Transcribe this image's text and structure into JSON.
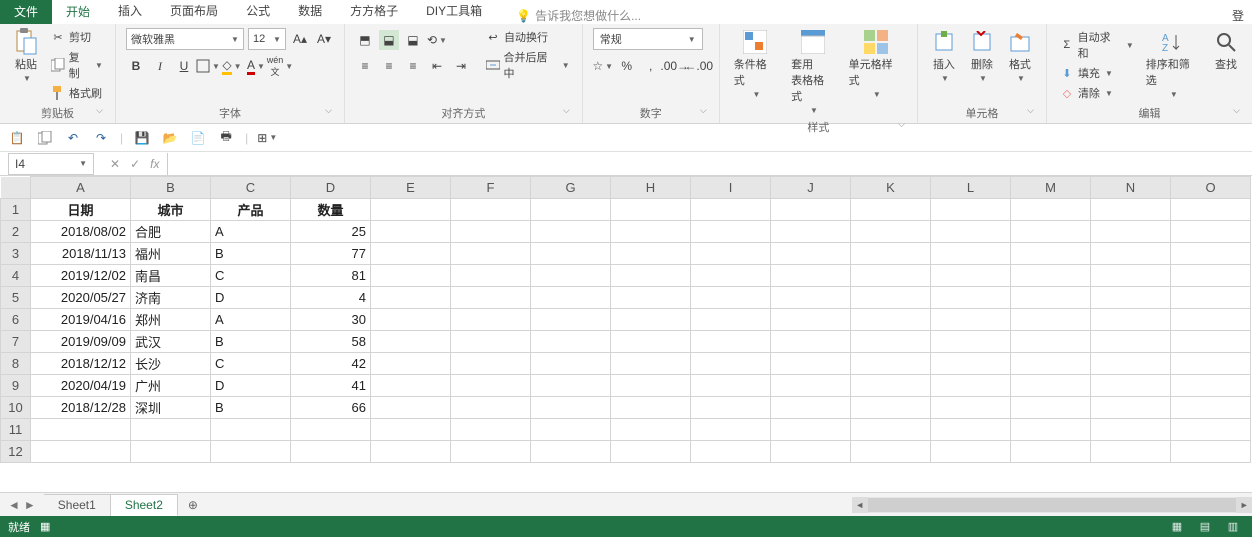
{
  "tabs": {
    "file": "文件",
    "items": [
      "开始",
      "插入",
      "页面布局",
      "公式",
      "数据",
      "方方格子",
      "DIY工具箱"
    ],
    "active": 0,
    "tellme_placeholder": "告诉我您想做什么...",
    "login": "登"
  },
  "clipboard": {
    "paste": "粘贴",
    "cut": "剪切",
    "copy": "复制",
    "format_painter": "格式刷",
    "group": "剪贴板"
  },
  "font": {
    "name": "微软雅黑",
    "size": "12",
    "group": "字体"
  },
  "align": {
    "wrap": "自动换行",
    "merge": "合并后居中",
    "group": "对齐方式"
  },
  "number": {
    "format": "常规",
    "group": "数字"
  },
  "styles": {
    "cond": "条件格式",
    "table": "套用\n表格格式",
    "cell": "单元格样式",
    "group": "样式"
  },
  "cells": {
    "insert": "插入",
    "delete": "删除",
    "format": "格式",
    "group": "单元格"
  },
  "editing": {
    "sum": "自动求和",
    "fill": "填充",
    "clear": "清除",
    "sort": "排序和筛选",
    "find": "查找",
    "group": "编辑"
  },
  "namebox": "I4",
  "cols": [
    "A",
    "B",
    "C",
    "D",
    "E",
    "F",
    "G",
    "H",
    "I",
    "J",
    "K",
    "L",
    "M",
    "N",
    "O"
  ],
  "headers": [
    "日期",
    "城市",
    "产品",
    "数量"
  ],
  "data": [
    [
      "2018/08/02",
      "合肥",
      "A",
      "25"
    ],
    [
      "2018/11/13",
      "福州",
      "B",
      "77"
    ],
    [
      "2019/12/02",
      "南昌",
      "C",
      "81"
    ],
    [
      "2020/05/27",
      "济南",
      "D",
      "4"
    ],
    [
      "2019/04/16",
      "郑州",
      "A",
      "30"
    ],
    [
      "2019/09/09",
      "武汉",
      "B",
      "58"
    ],
    [
      "2018/12/12",
      "长沙",
      "C",
      "42"
    ],
    [
      "2020/04/19",
      "广州",
      "D",
      "41"
    ],
    [
      "2018/12/28",
      "深圳",
      "B",
      "66"
    ]
  ],
  "total_rows": 12,
  "sheets": {
    "tabs": [
      "Sheet1",
      "Sheet2"
    ],
    "active": 1
  },
  "status": {
    "ready": "就绪"
  }
}
